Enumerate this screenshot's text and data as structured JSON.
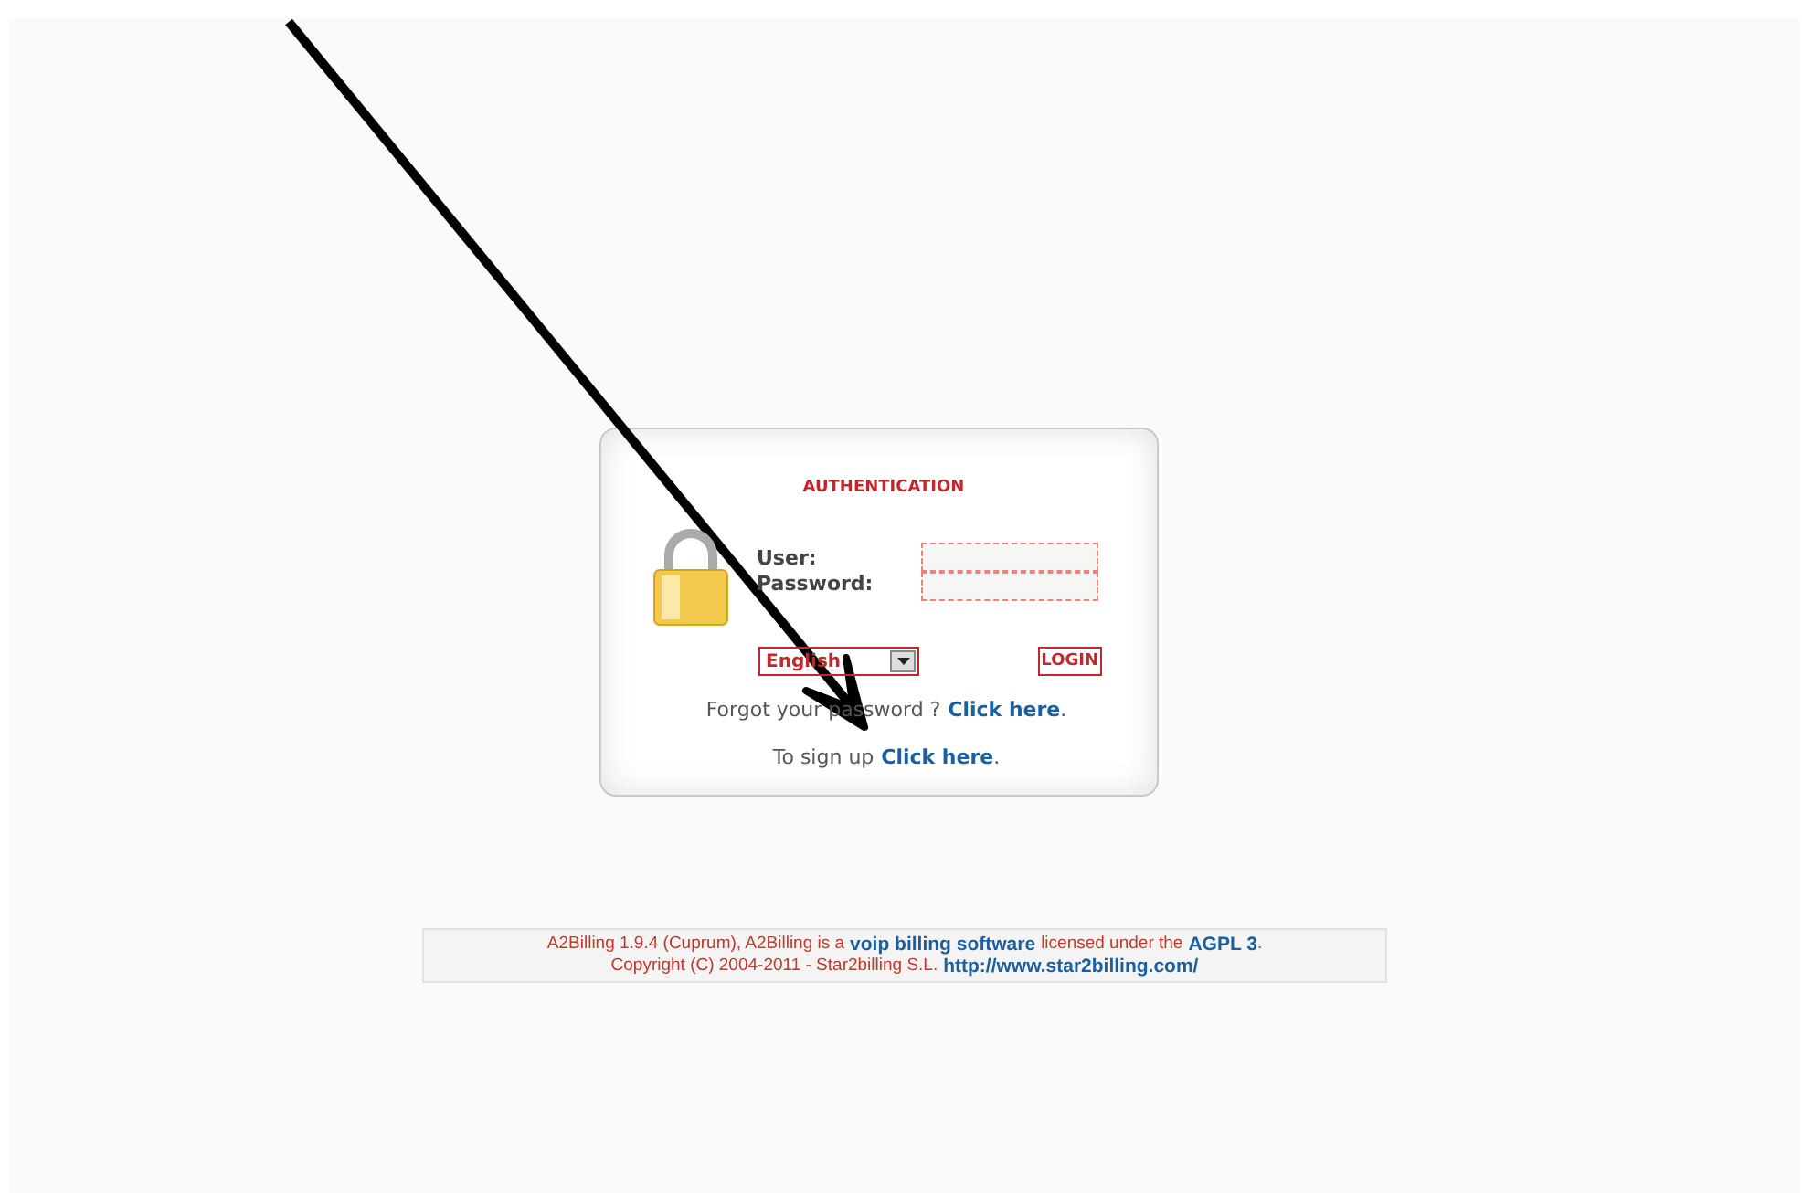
{
  "login_box": {
    "title": "AUTHENTICATION",
    "user_label": "User:",
    "password_label": "Password:",
    "language": "English",
    "login_button": "LOGIN",
    "forgot": [
      {
        "kind": "text",
        "text": "Forgot your password ?"
      },
      {
        "kind": "link",
        "text": "Click here"
      },
      {
        "kind": "punct",
        "text": "."
      }
    ],
    "signup": [
      {
        "kind": "text",
        "text": "To sign up"
      },
      {
        "kind": "link",
        "text": "Click here"
      },
      {
        "kind": "punct",
        "text": "."
      }
    ]
  },
  "footer": {
    "lines": [
      [
        {
          "kind": "text",
          "text": "A2Billing 1.9.4 (Cuprum), A2Billing is a"
        },
        {
          "kind": "link",
          "text": "voip billing software"
        },
        {
          "kind": "text",
          "text": "licensed under the"
        },
        {
          "kind": "link",
          "text": "AGPL 3"
        },
        {
          "kind": "punct",
          "text": "."
        }
      ],
      [
        {
          "kind": "text",
          "text": "Copyright (C) 2004-2011 - Star2billing S.L."
        },
        {
          "kind": "link",
          "text": "http://www.star2billing.com/"
        }
      ]
    ]
  }
}
